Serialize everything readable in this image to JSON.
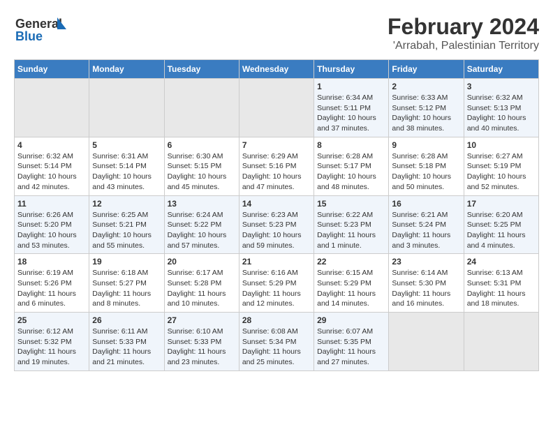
{
  "logo": {
    "text_general": "General",
    "text_blue": "Blue"
  },
  "title": "February 2024",
  "subtitle": "'Arrabah, Palestinian Territory",
  "days_of_week": [
    "Sunday",
    "Monday",
    "Tuesday",
    "Wednesday",
    "Thursday",
    "Friday",
    "Saturday"
  ],
  "weeks": [
    [
      {
        "day": "",
        "info": ""
      },
      {
        "day": "",
        "info": ""
      },
      {
        "day": "",
        "info": ""
      },
      {
        "day": "",
        "info": ""
      },
      {
        "day": "1",
        "info": "Sunrise: 6:34 AM\nSunset: 5:11 PM\nDaylight: 10 hours\nand 37 minutes."
      },
      {
        "day": "2",
        "info": "Sunrise: 6:33 AM\nSunset: 5:12 PM\nDaylight: 10 hours\nand 38 minutes."
      },
      {
        "day": "3",
        "info": "Sunrise: 6:32 AM\nSunset: 5:13 PM\nDaylight: 10 hours\nand 40 minutes."
      }
    ],
    [
      {
        "day": "4",
        "info": "Sunrise: 6:32 AM\nSunset: 5:14 PM\nDaylight: 10 hours\nand 42 minutes."
      },
      {
        "day": "5",
        "info": "Sunrise: 6:31 AM\nSunset: 5:14 PM\nDaylight: 10 hours\nand 43 minutes."
      },
      {
        "day": "6",
        "info": "Sunrise: 6:30 AM\nSunset: 5:15 PM\nDaylight: 10 hours\nand 45 minutes."
      },
      {
        "day": "7",
        "info": "Sunrise: 6:29 AM\nSunset: 5:16 PM\nDaylight: 10 hours\nand 47 minutes."
      },
      {
        "day": "8",
        "info": "Sunrise: 6:28 AM\nSunset: 5:17 PM\nDaylight: 10 hours\nand 48 minutes."
      },
      {
        "day": "9",
        "info": "Sunrise: 6:28 AM\nSunset: 5:18 PM\nDaylight: 10 hours\nand 50 minutes."
      },
      {
        "day": "10",
        "info": "Sunrise: 6:27 AM\nSunset: 5:19 PM\nDaylight: 10 hours\nand 52 minutes."
      }
    ],
    [
      {
        "day": "11",
        "info": "Sunrise: 6:26 AM\nSunset: 5:20 PM\nDaylight: 10 hours\nand 53 minutes."
      },
      {
        "day": "12",
        "info": "Sunrise: 6:25 AM\nSunset: 5:21 PM\nDaylight: 10 hours\nand 55 minutes."
      },
      {
        "day": "13",
        "info": "Sunrise: 6:24 AM\nSunset: 5:22 PM\nDaylight: 10 hours\nand 57 minutes."
      },
      {
        "day": "14",
        "info": "Sunrise: 6:23 AM\nSunset: 5:23 PM\nDaylight: 10 hours\nand 59 minutes."
      },
      {
        "day": "15",
        "info": "Sunrise: 6:22 AM\nSunset: 5:23 PM\nDaylight: 11 hours\nand 1 minute."
      },
      {
        "day": "16",
        "info": "Sunrise: 6:21 AM\nSunset: 5:24 PM\nDaylight: 11 hours\nand 3 minutes."
      },
      {
        "day": "17",
        "info": "Sunrise: 6:20 AM\nSunset: 5:25 PM\nDaylight: 11 hours\nand 4 minutes."
      }
    ],
    [
      {
        "day": "18",
        "info": "Sunrise: 6:19 AM\nSunset: 5:26 PM\nDaylight: 11 hours\nand 6 minutes."
      },
      {
        "day": "19",
        "info": "Sunrise: 6:18 AM\nSunset: 5:27 PM\nDaylight: 11 hours\nand 8 minutes."
      },
      {
        "day": "20",
        "info": "Sunrise: 6:17 AM\nSunset: 5:28 PM\nDaylight: 11 hours\nand 10 minutes."
      },
      {
        "day": "21",
        "info": "Sunrise: 6:16 AM\nSunset: 5:29 PM\nDaylight: 11 hours\nand 12 minutes."
      },
      {
        "day": "22",
        "info": "Sunrise: 6:15 AM\nSunset: 5:29 PM\nDaylight: 11 hours\nand 14 minutes."
      },
      {
        "day": "23",
        "info": "Sunrise: 6:14 AM\nSunset: 5:30 PM\nDaylight: 11 hours\nand 16 minutes."
      },
      {
        "day": "24",
        "info": "Sunrise: 6:13 AM\nSunset: 5:31 PM\nDaylight: 11 hours\nand 18 minutes."
      }
    ],
    [
      {
        "day": "25",
        "info": "Sunrise: 6:12 AM\nSunset: 5:32 PM\nDaylight: 11 hours\nand 19 minutes."
      },
      {
        "day": "26",
        "info": "Sunrise: 6:11 AM\nSunset: 5:33 PM\nDaylight: 11 hours\nand 21 minutes."
      },
      {
        "day": "27",
        "info": "Sunrise: 6:10 AM\nSunset: 5:33 PM\nDaylight: 11 hours\nand 23 minutes."
      },
      {
        "day": "28",
        "info": "Sunrise: 6:08 AM\nSunset: 5:34 PM\nDaylight: 11 hours\nand 25 minutes."
      },
      {
        "day": "29",
        "info": "Sunrise: 6:07 AM\nSunset: 5:35 PM\nDaylight: 11 hours\nand 27 minutes."
      },
      {
        "day": "",
        "info": ""
      },
      {
        "day": "",
        "info": ""
      }
    ]
  ]
}
